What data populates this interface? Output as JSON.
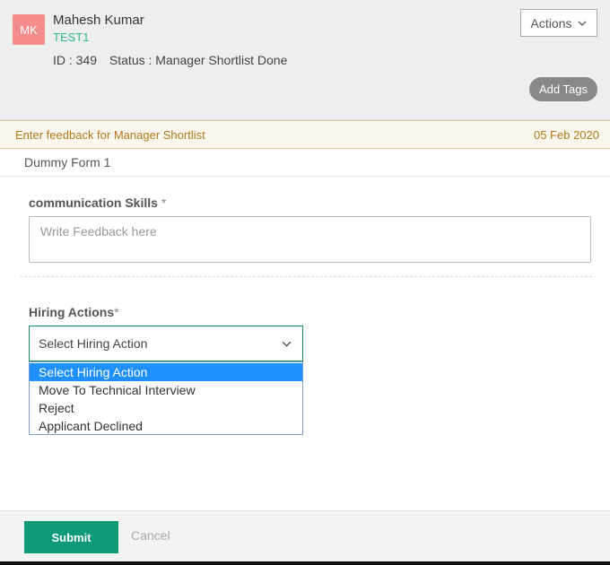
{
  "candidate": {
    "initials": "MK",
    "name": "Mahesh Kumar",
    "code": "TEST1",
    "id_text": "ID : 349",
    "status_text": "Status : Manager Shortlist Done"
  },
  "header": {
    "actions_label": "Actions",
    "add_tags_label": "Add Tags"
  },
  "feedback_strip": {
    "prompt": "Enter feedback for Manager Shortlist",
    "date": "05 Feb 2020"
  },
  "form": {
    "title": "Dummy Form 1",
    "communication": {
      "label": "communication Skills",
      "required_mark": " *",
      "placeholder": "Write Feedback here"
    },
    "hiring": {
      "label": "Hiring Actions",
      "required_mark": "*",
      "selected": "Select Hiring Action",
      "options": [
        "Select Hiring Action",
        "Move To Technical Interview",
        "Reject",
        "Applicant Declined"
      ]
    }
  },
  "footer": {
    "submit_label": "Submit",
    "cancel_label": "Cancel"
  },
  "colors": {
    "avatar": "#f48c8c",
    "code": "#2dbb8e",
    "strip_text": "#b07a1b",
    "submit": "#0d9a76",
    "option_highlight": "#1e90ff"
  }
}
